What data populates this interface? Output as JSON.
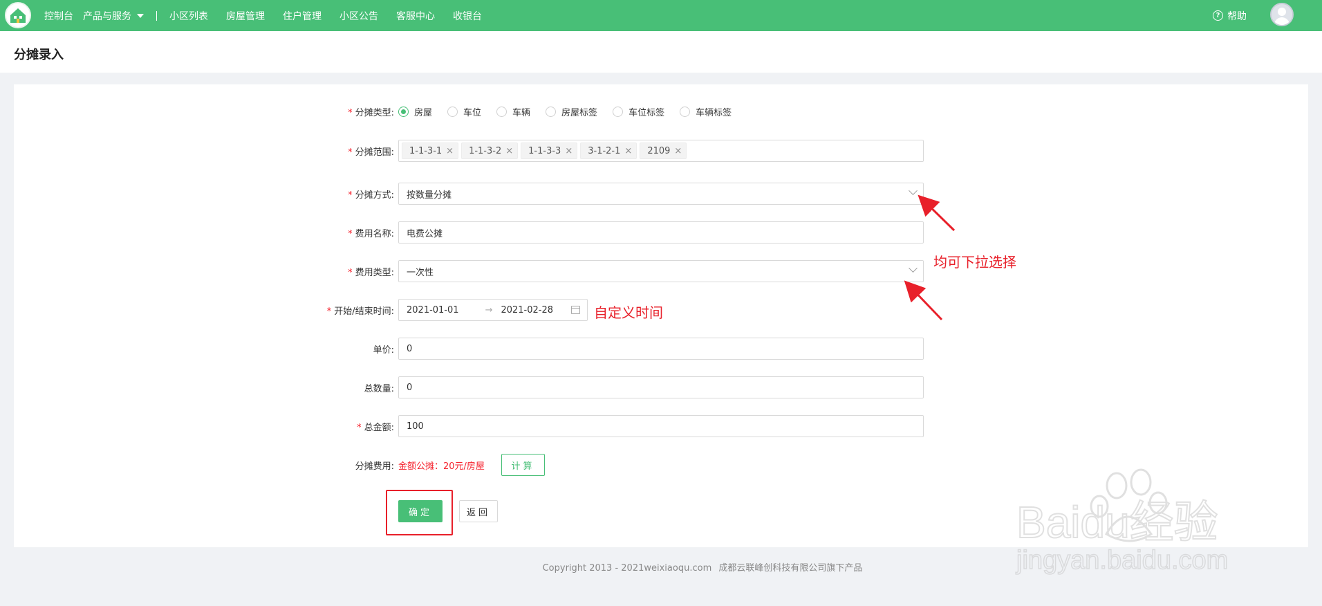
{
  "nav": {
    "items": [
      "控制台",
      "产品与服务",
      "小区列表",
      "房屋管理",
      "住户管理",
      "小区公告",
      "客服中心",
      "收银台"
    ],
    "help": "帮助"
  },
  "page": {
    "title": "分摊录入"
  },
  "form": {
    "type": {
      "label": "分摊类型:",
      "options": [
        "房屋",
        "车位",
        "车辆",
        "房屋标签",
        "车位标签",
        "车辆标签"
      ],
      "selected": "房屋"
    },
    "scope": {
      "label": "分摊范围:",
      "tags": [
        "1-1-3-1",
        "1-1-3-2",
        "1-1-3-3",
        "3-1-2-1",
        "2109"
      ]
    },
    "method": {
      "label": "分摊方式:",
      "value": "按数量分摊"
    },
    "fee_name": {
      "label": "费用名称:",
      "value": "电费公摊"
    },
    "fee_type": {
      "label": "费用类型:",
      "value": "一次性"
    },
    "date_range": {
      "label": "开始/结束时间:",
      "start": "2021-01-01",
      "end": "2021-02-28"
    },
    "unit_price": {
      "label": "单价:",
      "value": "0"
    },
    "total_qty": {
      "label": "总数量:",
      "value": "0"
    },
    "total_amount": {
      "label": "总金额:",
      "value": "100"
    },
    "fee_result": {
      "label": "分摊费用:",
      "text": "金额公摊：20元/房屋",
      "calc_label": "计算"
    },
    "confirm_label": "确定",
    "back_label": "返回"
  },
  "annotations": {
    "dropdown_note": "均可下拉选择",
    "time_note": "自定义时间"
  },
  "footer": {
    "copyright": "Copyright 2013 - 2021weixiaoqu.com",
    "company": "成都云联峰创科技有限公司旗下产品"
  },
  "watermark": {
    "brand": "Baidu经验",
    "url": "jingyan.baidu.com"
  },
  "colors": {
    "primary": "#48bf77",
    "annotation": "#e8202a",
    "required": "#f5222d"
  }
}
